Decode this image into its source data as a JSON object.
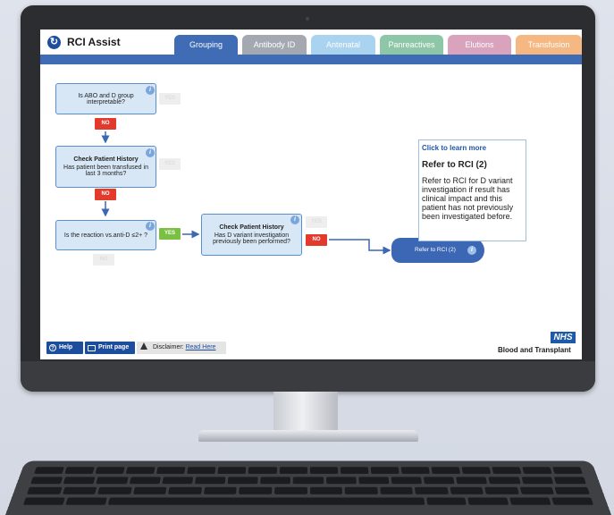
{
  "app": {
    "title": "RCI Assist",
    "logo_glyph": "↻"
  },
  "tabs": [
    {
      "label": "Grouping",
      "color": "#3f6cb5",
      "active": true
    },
    {
      "label": "Antibody ID",
      "color": "#a4a8b0"
    },
    {
      "label": "Antenatal",
      "color": "#a9d3ee"
    },
    {
      "label": "Panreactives",
      "color": "#8ec6a8"
    },
    {
      "label": "Elutions",
      "color": "#d9a3bd"
    },
    {
      "label": "Transfusion",
      "color": "#f6b883"
    }
  ],
  "flow": {
    "q1": {
      "text": "Is ABO and D group interpretable?",
      "yes": "YES",
      "no": "NO"
    },
    "q2": {
      "title": "Check Patient History",
      "text": "Has patient been transfused in last 3 months?",
      "yes": "YES",
      "no": "NO"
    },
    "q3": {
      "text": "Is the reaction vs.anti-D ≤2+ ?",
      "yes": "YES",
      "no": "NO"
    },
    "q4": {
      "title": "Check Patient History",
      "text": "Has D variant investigation previously been performed?",
      "yes": "YES",
      "no": "NO"
    },
    "result": {
      "label": "Refer to RCI (2)"
    },
    "info_glyph": "i"
  },
  "popup": {
    "link": "Click to learn more",
    "title": "Refer to RCI (2)",
    "body": "Refer to RCI for D variant investigation if result has clinical impact and this patient has not previously been investigated before."
  },
  "footer": {
    "help_label": "Help",
    "help_glyph": "?",
    "print_label": "Print page",
    "disclaimer_label": "Disclaimer:",
    "disclaimer_link": "Read Here",
    "nhs_logo": "NHS",
    "org_name": "Blood and Transplant"
  },
  "colors": {
    "accent": "#3f6cb5",
    "no": "#e23b2e",
    "yes": "#7ac143",
    "nhs_blue": "#1d5aa8"
  }
}
